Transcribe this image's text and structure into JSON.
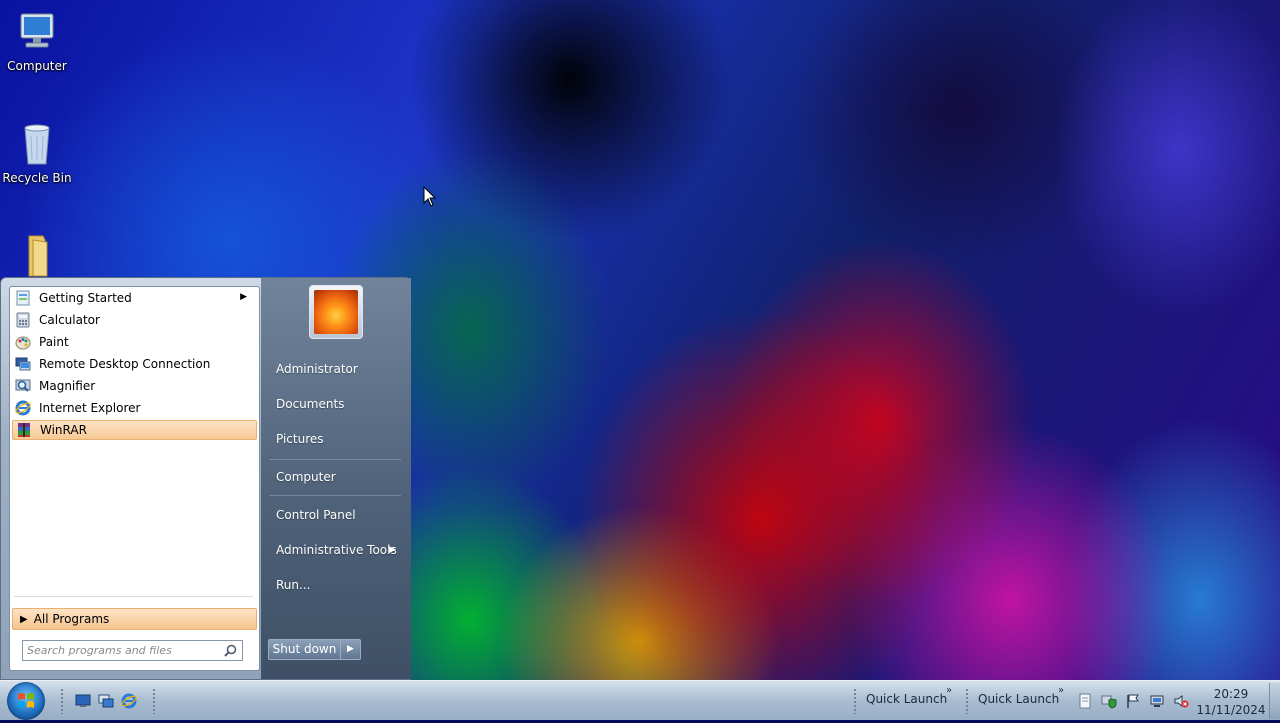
{
  "desktop": {
    "icons": [
      {
        "label": "Computer"
      },
      {
        "label": "Recycle Bin"
      },
      {
        "label": ""
      }
    ]
  },
  "start_menu": {
    "programs": [
      {
        "label": "Getting Started",
        "has_submenu": true
      },
      {
        "label": "Calculator"
      },
      {
        "label": "Paint"
      },
      {
        "label": "Remote Desktop Connection"
      },
      {
        "label": "Magnifier"
      },
      {
        "label": "Internet Explorer"
      },
      {
        "label": "WinRAR",
        "highlighted": true
      }
    ],
    "all_programs_label": "All Programs",
    "search_placeholder": "Search programs and files",
    "right_links": [
      {
        "label": "Administrator"
      },
      {
        "label": "Documents"
      },
      {
        "label": "Pictures"
      },
      {
        "label": "Computer"
      },
      {
        "label": "Control Panel"
      },
      {
        "label": "Administrative Tools",
        "has_submenu": true
      },
      {
        "label": "Run..."
      }
    ],
    "shutdown_label": "Shut down"
  },
  "taskbar": {
    "quick_launch_1": "Quick Launch",
    "quick_launch_2": "Quick Launch",
    "clock": {
      "time": "20:29",
      "date": "11/11/2024"
    }
  },
  "colors": {
    "highlight": "#f8c996",
    "right_pane": "#4f6279",
    "taskbar": "#a9bdd1"
  }
}
